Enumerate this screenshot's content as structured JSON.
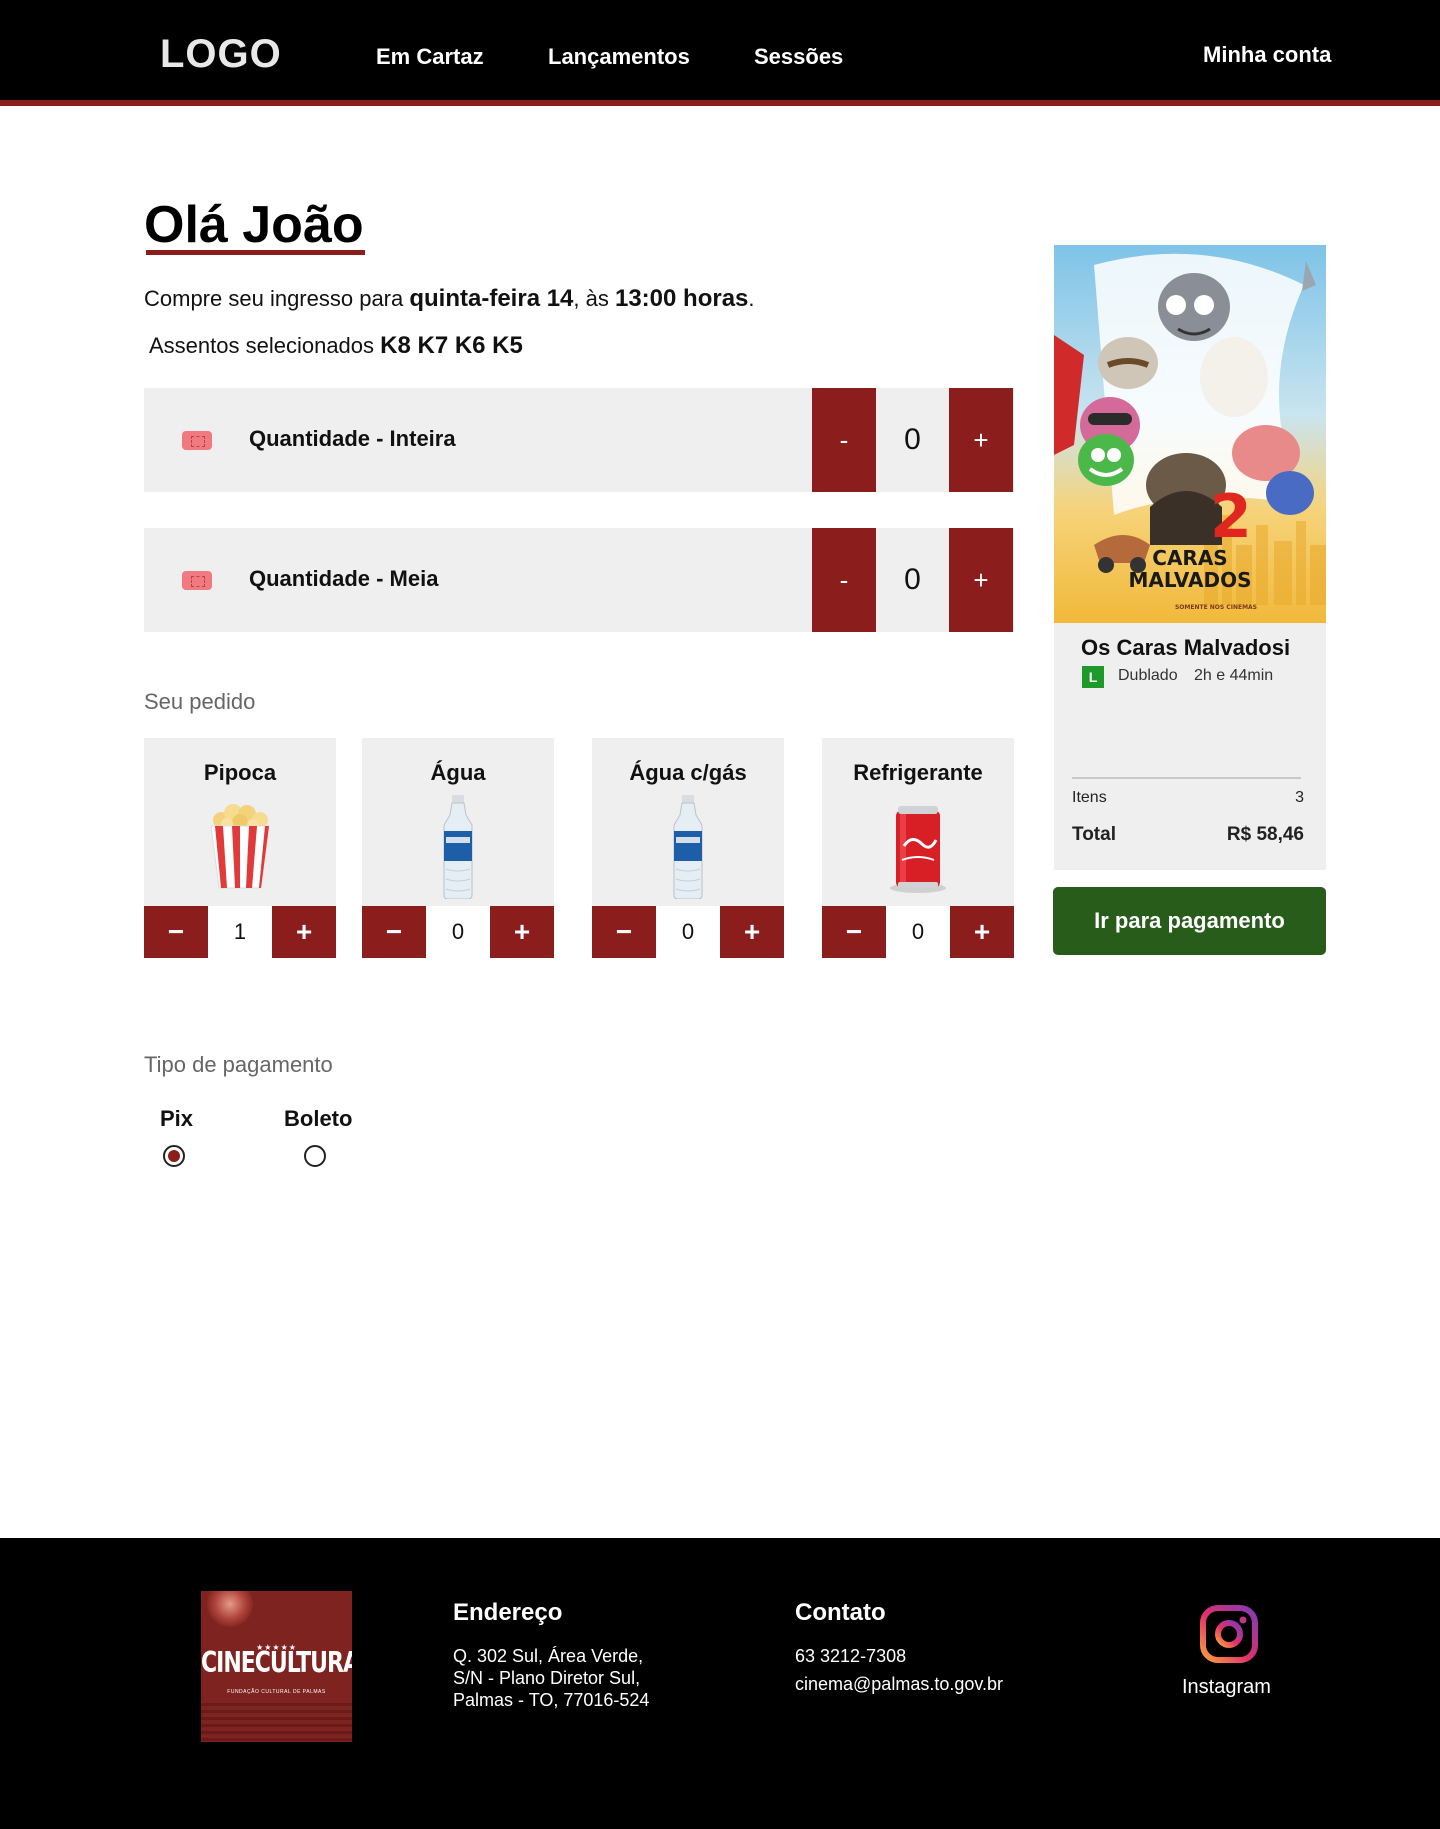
{
  "header": {
    "logo": "LOGO",
    "nav": [
      "Em Cartaz",
      "Lançamentos",
      "Sessões"
    ],
    "account": "Minha conta"
  },
  "greeting": "Olá João",
  "intro": {
    "prefix": "Compre seu ingresso para ",
    "day": "quinta-feira 14",
    "middle": ", às ",
    "time": "13:00 horas",
    "suffix": "."
  },
  "seats": {
    "label": "Assentos selecionados ",
    "list": "K8 K7 K6 K5"
  },
  "tickets": [
    {
      "label": "Quantidade - Inteira",
      "minus": "-",
      "value": "0",
      "plus": "+"
    },
    {
      "label": "Quantidade - Meia",
      "minus": "-",
      "value": "0",
      "plus": "+"
    }
  ],
  "order": {
    "title": "Seu pedido",
    "products": [
      {
        "name": "Pipoca",
        "minus": "−",
        "qty": "1",
        "plus": "+",
        "icon": "popcorn-icon"
      },
      {
        "name": "Água",
        "minus": "−",
        "qty": "0",
        "plus": "+",
        "icon": "water-bottle-icon"
      },
      {
        "name": "Água c/gás",
        "minus": "−",
        "qty": "0",
        "plus": "+",
        "icon": "water-bottle-icon"
      },
      {
        "name": "Refrigerante",
        "minus": "−",
        "qty": "0",
        "plus": "+",
        "icon": "soda-can-icon"
      }
    ]
  },
  "payment": {
    "title": "Tipo de pagamento",
    "options": [
      {
        "label": "Pix",
        "selected": true
      },
      {
        "label": "Boleto",
        "selected": false
      }
    ]
  },
  "summary": {
    "poster_title_line1": "CARAS",
    "poster_title_line2": "MALVADOS",
    "poster_number": "2",
    "poster_tagline": "SOMENTE NOS CINEMAS",
    "movie_title": "Os Caras Malvadosi",
    "rating": "L",
    "version": "Dublado",
    "duration": "2h e 44min",
    "items_label": "Itens",
    "items_value": "3",
    "total_label": "Total",
    "total_value": "R$ 58,46",
    "pay_button": "Ir para pagamento"
  },
  "footer": {
    "logo_stars": "★★★★★",
    "logo_text": "CINECULTURA",
    "logo_sub": "FUNDAÇÃO CULTURAL DE PALMAS",
    "address_title": "Endereço",
    "address_lines": [
      "Q. 302 Sul, Área Verde,",
      "S/N - Plano Diretor Sul,",
      "Palmas - TO, 77016-524"
    ],
    "contact_title": "Contato",
    "contact_lines": [
      "63 3212-7308",
      "cinema@palmas.to.gov.br"
    ],
    "instagram": "Instagram"
  },
  "colors": {
    "accent": "#8b1e1c",
    "panel": "#efefef",
    "pay_button": "#285c1a",
    "rating": "#1e9a2b"
  }
}
